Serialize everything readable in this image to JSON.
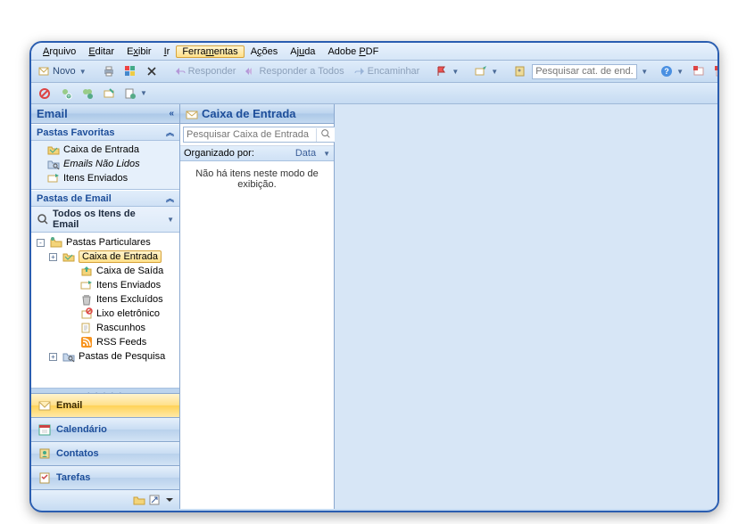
{
  "menubar": {
    "items": [
      {
        "label": "Arquivo",
        "u": 0
      },
      {
        "label": "Editar",
        "u": 0
      },
      {
        "label": "Exibir",
        "u": 1
      },
      {
        "label": "Ir",
        "u": 0
      },
      {
        "label": "Ferramentas",
        "u": 5,
        "highlight": true
      },
      {
        "label": "Ações",
        "u": 1
      },
      {
        "label": "Ajuda",
        "u": 2
      },
      {
        "label": "Adobe PDF",
        "u": 6
      }
    ]
  },
  "toolbar1": {
    "novo": "Novo",
    "responder": "Responder",
    "respondertodos": "Responder a Todos",
    "encaminhar": "Encaminhar",
    "search_placeholder": "Pesquisar cat. de end."
  },
  "nav": {
    "title": "Email",
    "fav_header": "Pastas Favoritas",
    "favorites": [
      {
        "label": "Caixa de Entrada",
        "icon": "inbox",
        "italic": false
      },
      {
        "label": "Emails Não Lidos",
        "icon": "search-folder",
        "italic": true
      },
      {
        "label": "Itens Enviados",
        "icon": "sent",
        "italic": false
      }
    ],
    "mail_header": "Pastas de Email",
    "all_items": "Todos os Itens de Email",
    "tree": [
      {
        "label": "Pastas Particulares",
        "icon": "personal",
        "lvl": 0,
        "exp": "-"
      },
      {
        "label": "Caixa de Entrada",
        "icon": "inbox",
        "lvl": 1,
        "exp": "+",
        "sel": true
      },
      {
        "label": "Caixa de Saída",
        "icon": "outbox",
        "lvl": 2
      },
      {
        "label": "Itens Enviados",
        "icon": "sent",
        "lvl": 2
      },
      {
        "label": "Itens Excluídos",
        "icon": "trash",
        "lvl": 2
      },
      {
        "label": "Lixo eletrônico",
        "icon": "junk",
        "lvl": 2
      },
      {
        "label": "Rascunhos",
        "icon": "drafts",
        "lvl": 2
      },
      {
        "label": "RSS Feeds",
        "icon": "rss",
        "lvl": 2
      },
      {
        "label": "Pastas de Pesquisa",
        "icon": "search-folder",
        "lvl": 1,
        "exp": "+"
      }
    ],
    "buttons": [
      {
        "label": "Email",
        "icon": "mail",
        "active": true
      },
      {
        "label": "Calendário",
        "icon": "calendar"
      },
      {
        "label": "Contatos",
        "icon": "contacts"
      },
      {
        "label": "Tarefas",
        "icon": "tasks"
      }
    ]
  },
  "mid": {
    "title": "Caixa de Entrada",
    "search_placeholder": "Pesquisar Caixa de Entrada",
    "organize_prefix": "Organizado por:",
    "organize_by": "Data",
    "empty": "Não há itens neste modo de exibição."
  }
}
